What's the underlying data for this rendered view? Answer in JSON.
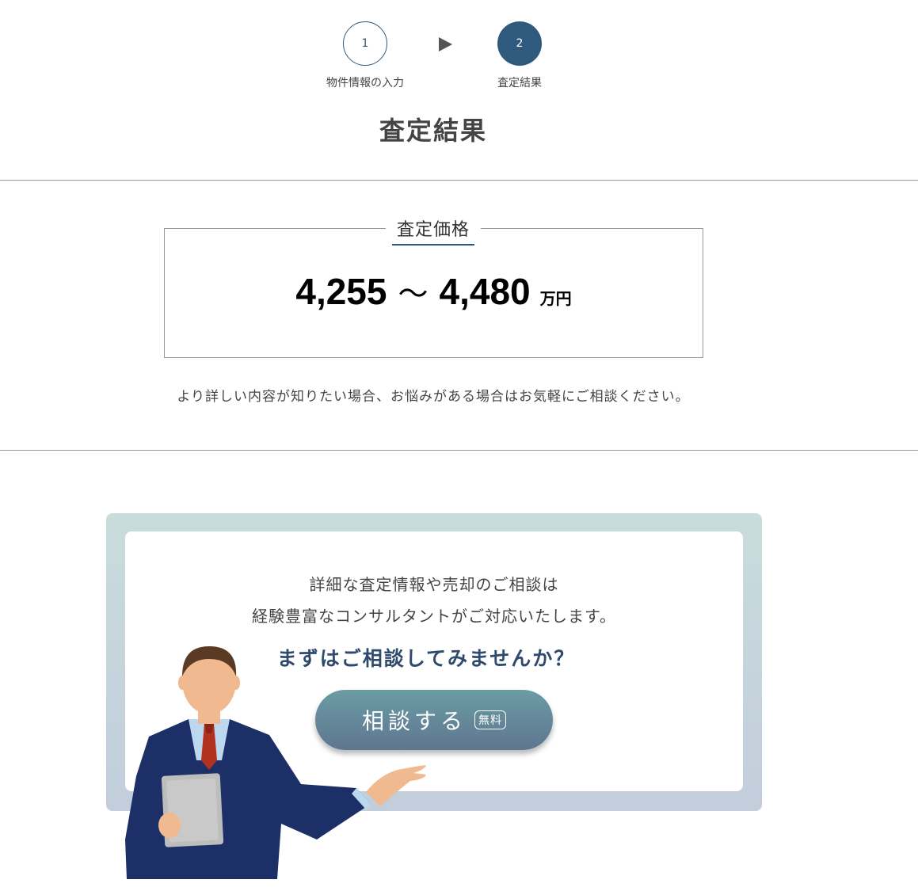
{
  "stepper": {
    "steps": [
      {
        "number": "1",
        "label": "物件情報の入力"
      },
      {
        "number": "2",
        "label": "査定結果"
      }
    ]
  },
  "page": {
    "title": "査定結果"
  },
  "price": {
    "legend": "査定価格",
    "low": "4,255",
    "separator": "〜",
    "high": "4,480",
    "unit": "万円"
  },
  "note": "より詳しい内容が知りたい場合、お悩みがある場合はお気軽にご相談ください。",
  "cta": {
    "line1": "詳細な査定情報や売却のご相談は",
    "line2": "経験豊富なコンサルタントがご対応いたします。",
    "question": "まずはご相談してみませんか？",
    "button_label": "相談する",
    "badge": "無料"
  },
  "colors": {
    "accent": "#2f5a7e",
    "question_text": "#2f4a6e",
    "button_top": "#6b9ca4",
    "button_bottom": "#5f7690"
  }
}
